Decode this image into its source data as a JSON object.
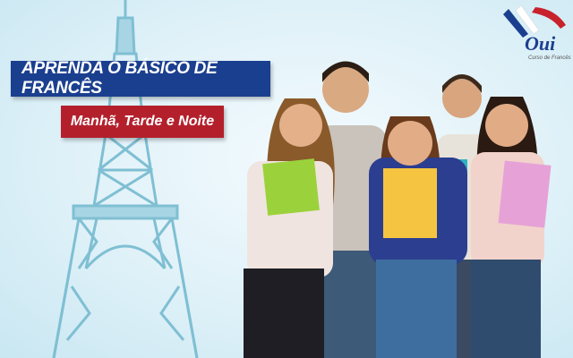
{
  "banner": {
    "headline": "APRENDA O BÁSICO  DE FRANCÊS",
    "schedule": "Manhã, Tarde e Noite"
  },
  "logo": {
    "wordmark": "Oui",
    "subtitle": "Curso de Francês"
  },
  "colors": {
    "banner_blue": "#1b3f8f",
    "banner_red": "#b3202c",
    "tower": "#7fbfd3",
    "background": "#dff1f8"
  },
  "icons": [
    "eiffel-tower-illustration",
    "oui-logo-flag-icon"
  ]
}
